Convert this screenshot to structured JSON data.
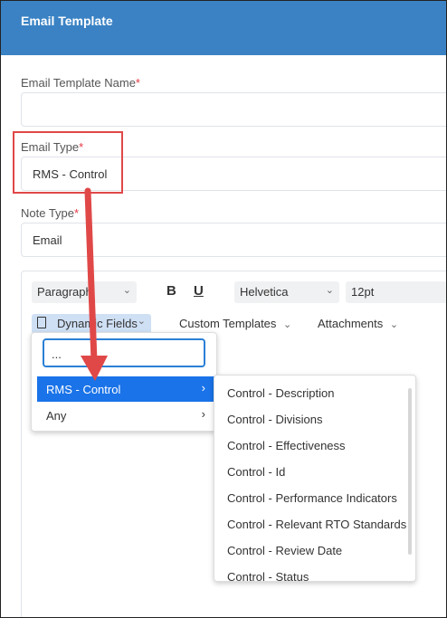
{
  "header": {
    "title": "Email Template"
  },
  "form": {
    "template_name": {
      "label": "Email Template Name",
      "required_mark": "*",
      "value": ""
    },
    "email_type": {
      "label": "Email Type",
      "required_mark": "*",
      "value": "RMS - Control"
    },
    "note_type": {
      "label": "Note Type",
      "required_mark": "*",
      "value": "Email"
    }
  },
  "toolbar": {
    "paragraph": "Paragraph",
    "bold": "B",
    "underline": "U",
    "font": "Helvetica",
    "size": "12pt",
    "dynamic_fields": "Dynamic Fields",
    "custom_templates": "Custom Templates",
    "attachments": "Attachments"
  },
  "dropdown": {
    "search_value": "...",
    "items": [
      {
        "label": "RMS - Control",
        "active": true
      },
      {
        "label": "Any",
        "active": false
      }
    ]
  },
  "submenu": {
    "items": [
      "Control - Description",
      "Control - Divisions",
      "Control - Effectiveness",
      "Control - Id",
      "Control - Performance Indicators",
      "Control - Relevant RTO Standards",
      "Control - Review Date",
      "Control - Status"
    ]
  },
  "colors": {
    "header": "#3a82c4",
    "highlight": "#e04848",
    "active": "#1a73e8"
  },
  "icons": [
    "document-icon",
    "chevron-down-icon",
    "chevron-right-icon",
    "annotation-arrow"
  ]
}
